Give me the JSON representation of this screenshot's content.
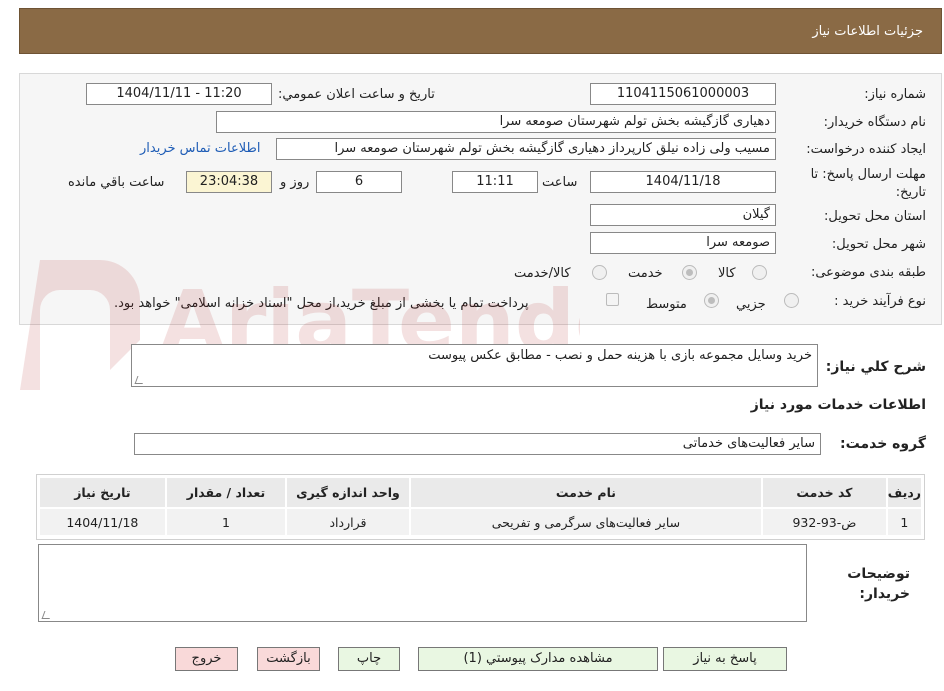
{
  "header": {
    "title": "جزئیات اطلاعات نیاز"
  },
  "form": {
    "need_number_label": "شماره نیاز:",
    "need_number": "1104115061000003",
    "announce_label": "تاریخ و ساعت اعلان عمومي:",
    "announce_value": "1404/11/11 - 11:20",
    "buyer_org_label": "نام دستگاه خریدار:",
    "buyer_org": "دهیاری گازگیشه بخش تولم شهرستان صومعه سرا",
    "requester_label": "ایجاد کننده درخواست:",
    "requester": "مسیب ولی زاده نیلق کارپرداز دهیاری گازگیشه بخش تولم شهرستان صومعه سرا",
    "contact_link": "اطلاعات تماس خریدار",
    "deadline_label": "مهلت ارسال پاسخ: تا تاریخ:",
    "deadline_date": "1404/11/18",
    "time_label": "ساعت",
    "deadline_time": "11:11",
    "days_value": "6",
    "days_label": "روز و",
    "remaining_time": "23:04:38",
    "remaining_label": "ساعت باقي مانده",
    "province_label": "استان محل تحویل:",
    "province": "گیلان",
    "city_label": "شهر محل تحویل:",
    "city": "صومعه سرا",
    "category_label": "طبقه بندی موضوعی:",
    "category_options": [
      "کالا",
      "خدمت",
      "کالا/خدمت"
    ],
    "category_selected": "خدمت",
    "process_label": "نوع فرآیند خرید :",
    "process_options": [
      "جزيي",
      "متوسط"
    ],
    "process_selected": "متوسط",
    "payment_note": "پرداخت تمام یا بخشی از مبلغ خرید،از محل \"اسناد خزانه اسلامی\" خواهد بود."
  },
  "description": {
    "label": "شرح کلي نیاز:",
    "value": "خرید وسایل مجموعه بازی با هزینه حمل و نصب - مطابق عکس پیوست"
  },
  "services": {
    "section_title": "اطلاعات خدمات مورد نیاز",
    "group_label": "گروه خدمت:",
    "group_value": "سایر فعالیت‌های خدماتی",
    "columns": [
      "ردیف",
      "کد خدمت",
      "نام خدمت",
      "واحد اندازه گیری",
      "تعداد / مقدار",
      "تاریخ نیاز"
    ],
    "rows": [
      {
        "row": "1",
        "code": "ض-93-932",
        "name": "سایر فعالیت‌های سرگرمی و تفریحی",
        "unit": "قرارداد",
        "qty": "1",
        "date": "1404/11/18"
      }
    ]
  },
  "buyer_notes": {
    "label_line1": "توضیحات",
    "label_line2": "خریدار:",
    "value": ""
  },
  "buttons": {
    "reply": "پاسخ به نیاز",
    "attachments": "مشاهده مدارک پیوستي (1)",
    "print": "چاپ",
    "back": "بازگشت",
    "exit": "خروج"
  },
  "colors": {
    "header_bg": "#8a6a45",
    "link": "#1f5db6",
    "button_green": "#e9f7e2",
    "button_pink": "#f9d9d9",
    "remaining_bg": "#fbf5d3"
  },
  "watermark_icon": "aria-tender-logo-watermark"
}
